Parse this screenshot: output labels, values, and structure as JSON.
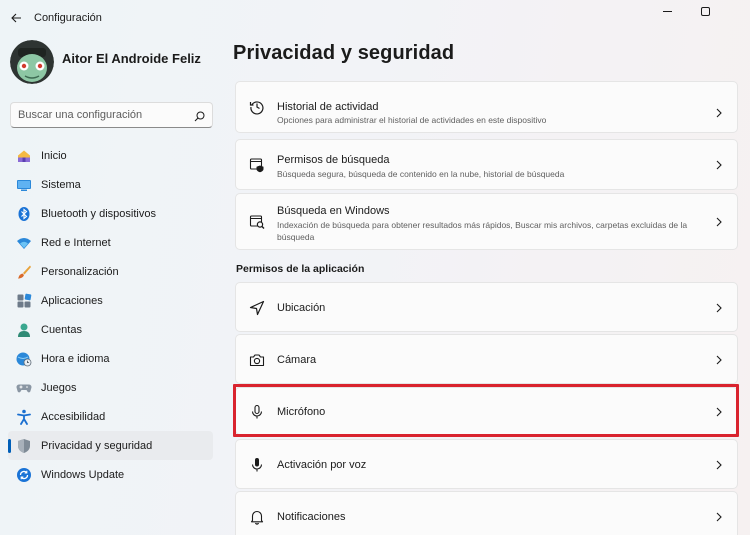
{
  "window": {
    "title": "Configuración"
  },
  "profile": {
    "name": "Aitor El Androide Feliz"
  },
  "search": {
    "placeholder": "Buscar una configuración"
  },
  "sidebar": {
    "items": [
      {
        "label": "Inicio",
        "icon": "home-icon"
      },
      {
        "label": "Sistema",
        "icon": "monitor-icon"
      },
      {
        "label": "Bluetooth y dispositivos",
        "icon": "bluetooth-icon"
      },
      {
        "label": "Red e Internet",
        "icon": "wifi-icon"
      },
      {
        "label": "Personalización",
        "icon": "brush-icon"
      },
      {
        "label": "Aplicaciones",
        "icon": "apps-icon"
      },
      {
        "label": "Cuentas",
        "icon": "user-icon"
      },
      {
        "label": "Hora e idioma",
        "icon": "globe-clock-icon"
      },
      {
        "label": "Juegos",
        "icon": "gamepad-icon"
      },
      {
        "label": "Accesibilidad",
        "icon": "accessibility-icon"
      },
      {
        "label": "Privacidad y seguridad",
        "icon": "shield-icon",
        "selected": true
      },
      {
        "label": "Windows Update",
        "icon": "update-icon"
      }
    ]
  },
  "main": {
    "title": "Privacidad y seguridad",
    "top_cards": [
      {
        "title": "Historial de actividad",
        "desc": "Opciones para administrar el historial de actividades en este dispositivo",
        "icon": "history-icon"
      },
      {
        "title": "Permisos de búsqueda",
        "desc": "Búsqueda segura, búsqueda de contenido en la nube, historial de búsqueda",
        "icon": "search-permissions-icon"
      },
      {
        "title": "Búsqueda en Windows",
        "desc": "Indexación de búsqueda para obtener resultados más rápidos, Buscar mis archivos, carpetas excluidas de la búsqueda",
        "icon": "windows-search-icon"
      }
    ],
    "section_header": "Permisos de la aplicación",
    "app_permissions": [
      {
        "title": "Ubicación",
        "icon": "location-icon"
      },
      {
        "title": "Cámara",
        "icon": "camera-icon"
      },
      {
        "title": "Micrófono",
        "icon": "microphone-icon",
        "highlighted": true
      },
      {
        "title": "Activación por voz",
        "icon": "voice-activation-icon"
      },
      {
        "title": "Notificaciones",
        "icon": "bell-icon"
      }
    ]
  },
  "colors": {
    "accent": "#005fb8",
    "highlight": "#d9232e"
  }
}
